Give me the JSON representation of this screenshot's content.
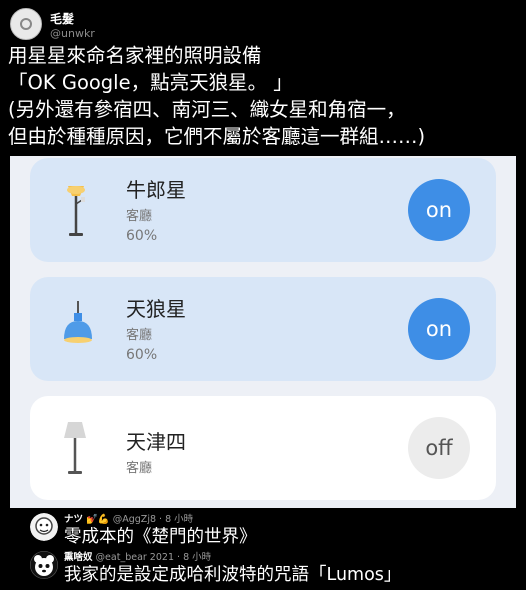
{
  "post": {
    "author_name": "毛髮",
    "author_handle": "@unwkr",
    "lines": [
      "用星星來命名家裡的照明設備",
      "「OK Google，點亮天狼星。 」",
      "(另外還有參宿四、南河三、織女星和角宿一，",
      "但由於種種原因，它們不屬於客廳這一群組……)"
    ]
  },
  "devices": [
    {
      "name": "牛郎星",
      "room": "客廳",
      "level": "60%",
      "state": "on",
      "icon": "floor-lamp-lit-icon"
    },
    {
      "name": "天狼星",
      "room": "客廳",
      "level": "60%",
      "state": "on",
      "icon": "pendant-lamp-icon"
    },
    {
      "name": "天津四",
      "room": "客廳",
      "level": "",
      "state": "off",
      "icon": "floor-lamp-off-icon"
    }
  ],
  "comments": [
    {
      "name": "ナツ",
      "emoji": "💅💪",
      "handle": "@AggZj8",
      "time": "8 小時",
      "text": "零成本的《楚門的世界》"
    },
    {
      "name": "熏啥奴",
      "handle": "@eat_bear 2021",
      "time": "8 小時",
      "text": "我家的是設定成哈利波特的咒語「Lumos」"
    }
  ]
}
